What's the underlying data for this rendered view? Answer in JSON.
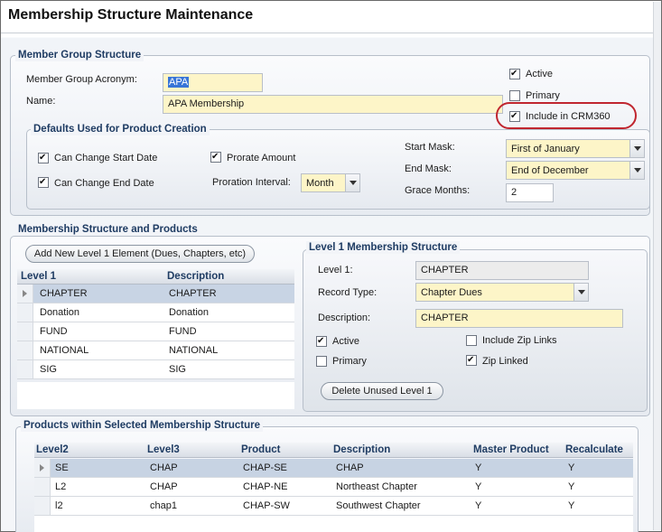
{
  "page": {
    "title": "Membership Structure Maintenance"
  },
  "member_group": {
    "section_title": "Member Group Structure",
    "acronym_label": "Member Group Acronym:",
    "acronym_value": "APA",
    "name_label": "Name:",
    "name_value": "APA Membership",
    "active_label": "Active",
    "active_checked": true,
    "primary_label": "Primary",
    "primary_checked": false,
    "crm_label": "Include in CRM360",
    "crm_checked": true
  },
  "defaults": {
    "section_title": "Defaults Used for Product Creation",
    "can_change_start_label": "Can Change Start Date",
    "can_change_end_label": "Can Change End Date",
    "prorate_label": "Prorate Amount",
    "proration_interval_label": "Proration Interval:",
    "proration_interval_value": "Month",
    "start_mask_label": "Start Mask:",
    "start_mask_value": "First of January",
    "end_mask_label": "End Mask:",
    "end_mask_value": "End of December",
    "grace_months_label": "Grace Months:",
    "grace_months_value": "2"
  },
  "structure": {
    "section_title": "Membership Structure and Products",
    "add_button": "Add New Level 1 Element (Dues, Chapters, etc)",
    "columns": [
      "Level 1",
      "Description"
    ],
    "rows": [
      [
        "CHAPTER",
        "CHAPTER"
      ],
      [
        "Donation",
        "Donation"
      ],
      [
        "FUND",
        "FUND"
      ],
      [
        "NATIONAL",
        "NATIONAL"
      ],
      [
        "SIG",
        "SIG"
      ]
    ]
  },
  "level1": {
    "section_title": "Level 1 Membership Structure",
    "level1_label": "Level 1:",
    "level1_value": "CHAPTER",
    "record_type_label": "Record Type:",
    "record_type_value": "Chapter Dues",
    "description_label": "Description:",
    "description_value": "CHAPTER",
    "active_label": "Active",
    "primary_label": "Primary",
    "include_zip_label": "Include Zip Links",
    "zip_linked_label": "Zip Linked",
    "delete_button": "Delete Unused Level 1"
  },
  "products": {
    "section_title": "Products within Selected Membership Structure",
    "columns": [
      "Level2",
      "Level3",
      "Product",
      "Description",
      "Master Product",
      "Recalculate"
    ],
    "rows": [
      [
        "SE",
        "CHAP",
        "CHAP-SE",
        "CHAP",
        "Y",
        "Y"
      ],
      [
        "L2",
        "CHAP",
        "CHAP-NE",
        "Northeast Chapter",
        "Y",
        "Y"
      ],
      [
        "l2",
        "chap1",
        "CHAP-SW",
        "Southwest Chapter",
        "Y",
        "Y"
      ]
    ]
  }
}
